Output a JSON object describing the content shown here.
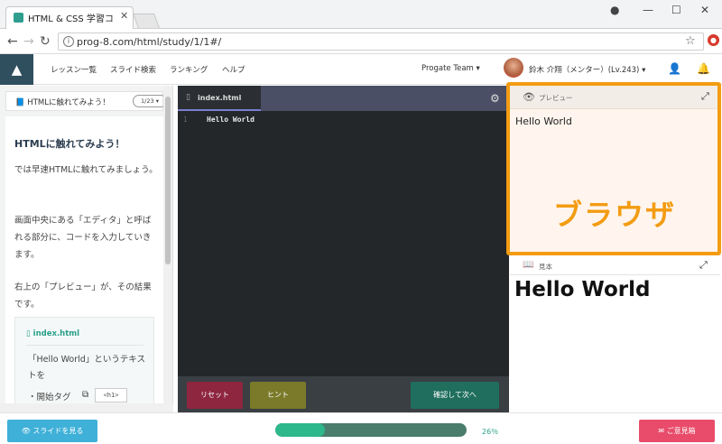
{
  "browser": {
    "tab_title": "HTML & CSS 学習コース",
    "url": "prog-8.com/html/study/1/1#/",
    "colors": {
      "extension_badge": "#d53a2a"
    }
  },
  "header": {
    "nav": [
      "レッスン一覧",
      "スライド検索",
      "ランキング",
      "ヘルプ"
    ],
    "team": "Progate Team",
    "user": "鈴木 介翔（メンター）(Lv.243)"
  },
  "lesson": {
    "title": "HTMLに触れてみよう！",
    "page": "1/23",
    "heading": "HTMLに触れてみよう！",
    "paragraphs": [
      "では早速HTMLに触れてみましょう。",
      "画面中央にある「エディタ」と呼ばれる部分に、コードを入力していきます。",
      "右上の「プレビュー」が、その結果です。"
    ],
    "card": {
      "filename": "index.html",
      "text": "「Hello World」というテキストを",
      "bullet": "・開始タグ",
      "tag": "<h1>"
    }
  },
  "editor": {
    "filename": "index.html",
    "line_number": "1",
    "code": "Hello World",
    "buttons": {
      "reset": "リセット",
      "hint": "ヒント",
      "next": "確認して次へ"
    }
  },
  "preview": {
    "label": "プレビュー",
    "output": "Hello World",
    "annotation": "ブラウザ",
    "accent_color": "#f39c12"
  },
  "sample": {
    "label": "見本",
    "output": "Hello World"
  },
  "footer": {
    "slides_button": "スライドを見る",
    "progress": 26,
    "progress_label": "26％",
    "feedback_button": "ご意見箱"
  }
}
